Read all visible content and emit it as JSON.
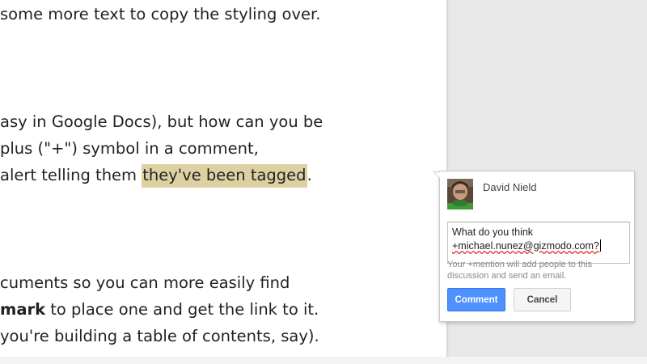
{
  "document": {
    "line1": "some more text to copy the styling over.",
    "line2": "asy in Google Docs), but how can you be",
    "line3": " plus (\"+\") symbol in a comment,",
    "line4_pre": " alert telling them ",
    "line4_highlight": "they've been tagged",
    "line4_post": ".",
    "line5": "cuments so you can more easily find",
    "line6_bold": "mark",
    "line6_rest": " to place one and get the link to it.",
    "line7": "you're building a table of contents, say)."
  },
  "comment": {
    "author": "David Nield",
    "input_line1": "What do you think",
    "input_line2": "+michael.nunez@gizmodo.com?",
    "hint": "Your +mention will add people to this discussion and send an email.",
    "comment_button": "Comment",
    "cancel_button": "Cancel"
  },
  "colors": {
    "highlight": "#ddd0a2",
    "primary_button": "#4d90fe",
    "background": "#e8e8e8"
  },
  "icons": {
    "avatar": "user-avatar-photo"
  }
}
